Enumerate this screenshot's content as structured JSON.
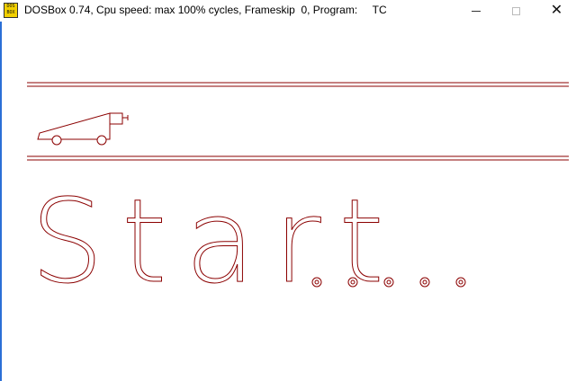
{
  "window": {
    "title": "DOSBox 0.74, Cpu speed: max 100% cycles, Frameskip  0, Program:     TC",
    "icon_name": "dosbox-icon",
    "icon_text": "DOS BOX",
    "buttons": {
      "minimize_icon": "minimize-icon",
      "maximize_icon": "maximize-icon",
      "close_label": "✕"
    }
  },
  "screen": {
    "line_color": "#8b0000",
    "accent_color": "#2b6fd6",
    "start_text": "Start",
    "ellipsis_dots": 5
  }
}
